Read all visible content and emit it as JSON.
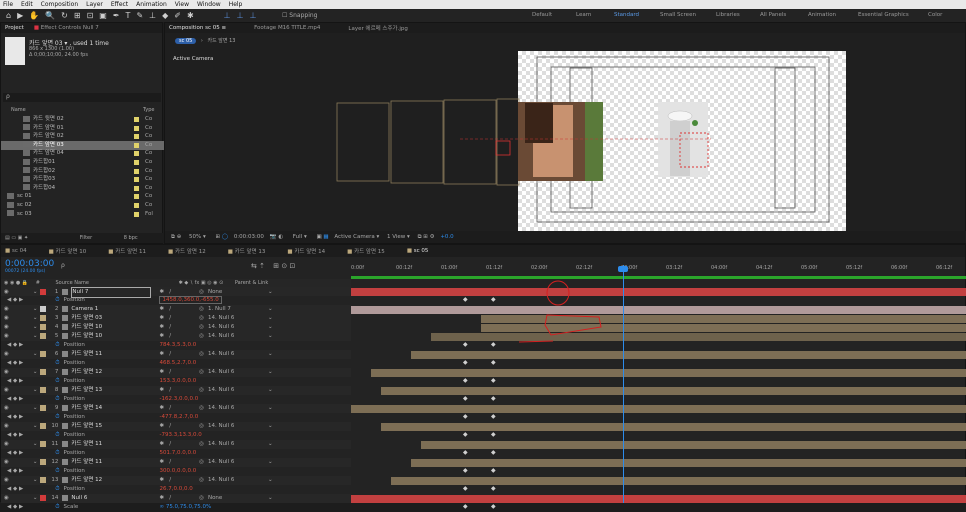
{
  "menu": [
    "File",
    "Edit",
    "Composition",
    "Layer",
    "Effect",
    "Animation",
    "View",
    "Window",
    "Help"
  ],
  "workspaces": [
    {
      "label": "Default",
      "active": false
    },
    {
      "label": "Learn",
      "active": false
    },
    {
      "label": "Standard",
      "active": true
    },
    {
      "label": "Small Screen",
      "active": false
    },
    {
      "label": "Libraries",
      "active": false
    },
    {
      "label": "All Panels",
      "active": false
    },
    {
      "label": "Animation",
      "active": false
    },
    {
      "label": "Essential Graphics",
      "active": false
    },
    {
      "label": "Color",
      "active": false
    }
  ],
  "snapping": "Snapping",
  "project": {
    "tab": "Project",
    "effect_tab": "Effect Controls Null 7",
    "item_name": "카드 앞면 03 ▾ , used 1 time",
    "item_dims": "866 x 1300 (1.00)",
    "item_dur": "Δ 0;00;10;00, 24.00 fps",
    "search_placeholder": "ρ",
    "col_name": "Name",
    "col_type": "Type",
    "items": [
      {
        "name": "카드 뒷면 02",
        "type": "Co",
        "color": "#e0d26a",
        "indent": 1,
        "selected": false
      },
      {
        "name": "카드 앞면 01",
        "type": "Co",
        "color": "#e0d26a",
        "indent": 1,
        "selected": false
      },
      {
        "name": "카드 앞면 02",
        "type": "Co",
        "color": "#e0d26a",
        "indent": 1,
        "selected": false
      },
      {
        "name": "카드 앞면 03",
        "type": "Co",
        "color": "#e0d26a",
        "indent": 1,
        "selected": true
      },
      {
        "name": "카드 앞면 04",
        "type": "Co",
        "color": "#e0d26a",
        "indent": 1,
        "selected": false
      },
      {
        "name": "카드합01",
        "type": "Co",
        "color": "#e0d26a",
        "indent": 1,
        "selected": false
      },
      {
        "name": "카드합02",
        "type": "Co",
        "color": "#e0d26a",
        "indent": 1,
        "selected": false
      },
      {
        "name": "카드합03",
        "type": "Co",
        "color": "#e0d26a",
        "indent": 1,
        "selected": false
      },
      {
        "name": "카드합04",
        "type": "Co",
        "color": "#e0d26a",
        "indent": 1,
        "selected": false
      },
      {
        "name": "sc 01",
        "type": "Co",
        "color": "#e0d26a",
        "indent": 0,
        "selected": false
      },
      {
        "name": "sc 02",
        "type": "Co",
        "color": "#e0d26a",
        "indent": 0,
        "selected": false
      },
      {
        "name": "sc 03",
        "type": "Fol",
        "color": "#e0d26a",
        "indent": 0,
        "selected": false
      }
    ],
    "footer_bpc": "8 bpc",
    "filter": "Filter"
  },
  "comp": {
    "tabs": [
      {
        "label": "Composition sc 05 ≡",
        "active": true
      },
      {
        "label": "Footage M16 TITLE.mp4",
        "active": false
      },
      {
        "label": "Layer 에르메 스주가.jpg",
        "active": false
      }
    ],
    "breadcrumb": [
      "sc 05",
      "카드 앞면 13"
    ],
    "active_camera": "Active Camera",
    "zoom": "50%",
    "timecode": "0:00:03:00",
    "resolution": "Full",
    "view": "Active Camera",
    "views": "1 View",
    "exposure": "+0.0"
  },
  "timeline": {
    "tabs": [
      "sc 04",
      "카드 앞면 10",
      "카드 앞면 11",
      "카드 앞면 12",
      "카드 앞면 13",
      "카드 앞면 14",
      "카드 앞면 15",
      "sc 05"
    ],
    "active_tab": "sc 05",
    "timecode": "0:00:03:00",
    "timecode_sub": "00072 (24.00 fps)",
    "search": "ρ",
    "col_source": "Source Name",
    "col_parent": "Parent & Link",
    "ruler": [
      "0:00f",
      "00:12f",
      "01:00f",
      "01:12f",
      "02:00f",
      "02:12f",
      "03:00f",
      "03:12f",
      "04:00f",
      "04:12f",
      "05:00f",
      "05:12f",
      "06:00f",
      "06:12f"
    ],
    "layers": [
      {
        "num": "1",
        "name": "Null 7",
        "color": "#d23b3b",
        "parent": "None",
        "prop": "Position",
        "val": "1458.0,360.0,-655.0",
        "boxed": true
      },
      {
        "num": "2",
        "name": "Camera 1",
        "color": "#ccc",
        "parent": "1. Null 7",
        "prop": null,
        "val": null
      },
      {
        "num": "3",
        "name": "카드 앞면 03",
        "color": "#bca87c",
        "parent": "14. Null 6",
        "prop": null,
        "val": null
      },
      {
        "num": "4",
        "name": "카드 앞면 10",
        "color": "#bca87c",
        "parent": "14. Null 6",
        "prop": null,
        "val": null
      },
      {
        "num": "5",
        "name": "카드 앞면 10",
        "color": "#bca87c",
        "parent": "14. Null 6",
        "prop": "Position",
        "val": "784.3,5.3,0.0"
      },
      {
        "num": "6",
        "name": "카드 앞면 11",
        "color": "#bca87c",
        "parent": "14. Null 6",
        "prop": "Position",
        "val": "468.5,2.7,0.0"
      },
      {
        "num": "7",
        "name": "카드 앞면 12",
        "color": "#bca87c",
        "parent": "14. Null 6",
        "prop": "Position",
        "val": "153.3,0.0,0.0"
      },
      {
        "num": "8",
        "name": "카드 앞면 13",
        "color": "#bca87c",
        "parent": "14. Null 6",
        "prop": "Position",
        "val": "-162.3,0.0,0.0"
      },
      {
        "num": "9",
        "name": "카드 앞면 14",
        "color": "#bca87c",
        "parent": "14. Null 6",
        "prop": "Position",
        "val": "-477.8,2.7,0.0"
      },
      {
        "num": "10",
        "name": "카드 앞면 15",
        "color": "#bca87c",
        "parent": "14. Null 6",
        "prop": "Position",
        "val": "-793.3,13.3,0.0"
      },
      {
        "num": "11",
        "name": "카드 앞면 11",
        "color": "#bca87c",
        "parent": "14. Null 6",
        "prop": "Position",
        "val": "501.7,0.0,0.0"
      },
      {
        "num": "12",
        "name": "카드 앞면 11",
        "color": "#bca87c",
        "parent": "14. Null 6",
        "prop": "Position",
        "val": "300.0,0.0,0.0"
      },
      {
        "num": "13",
        "name": "카드 앞면 12",
        "color": "#bca87c",
        "parent": "14. Null 6",
        "prop": "Position",
        "val": "26.7,0.0,0.0"
      },
      {
        "num": "14",
        "name": "Null 6",
        "color": "#d23b3b",
        "parent": "None",
        "prop": "Scale",
        "val": "∞ 75.0,75.0,75.0%"
      }
    ],
    "parent_none": "None"
  }
}
